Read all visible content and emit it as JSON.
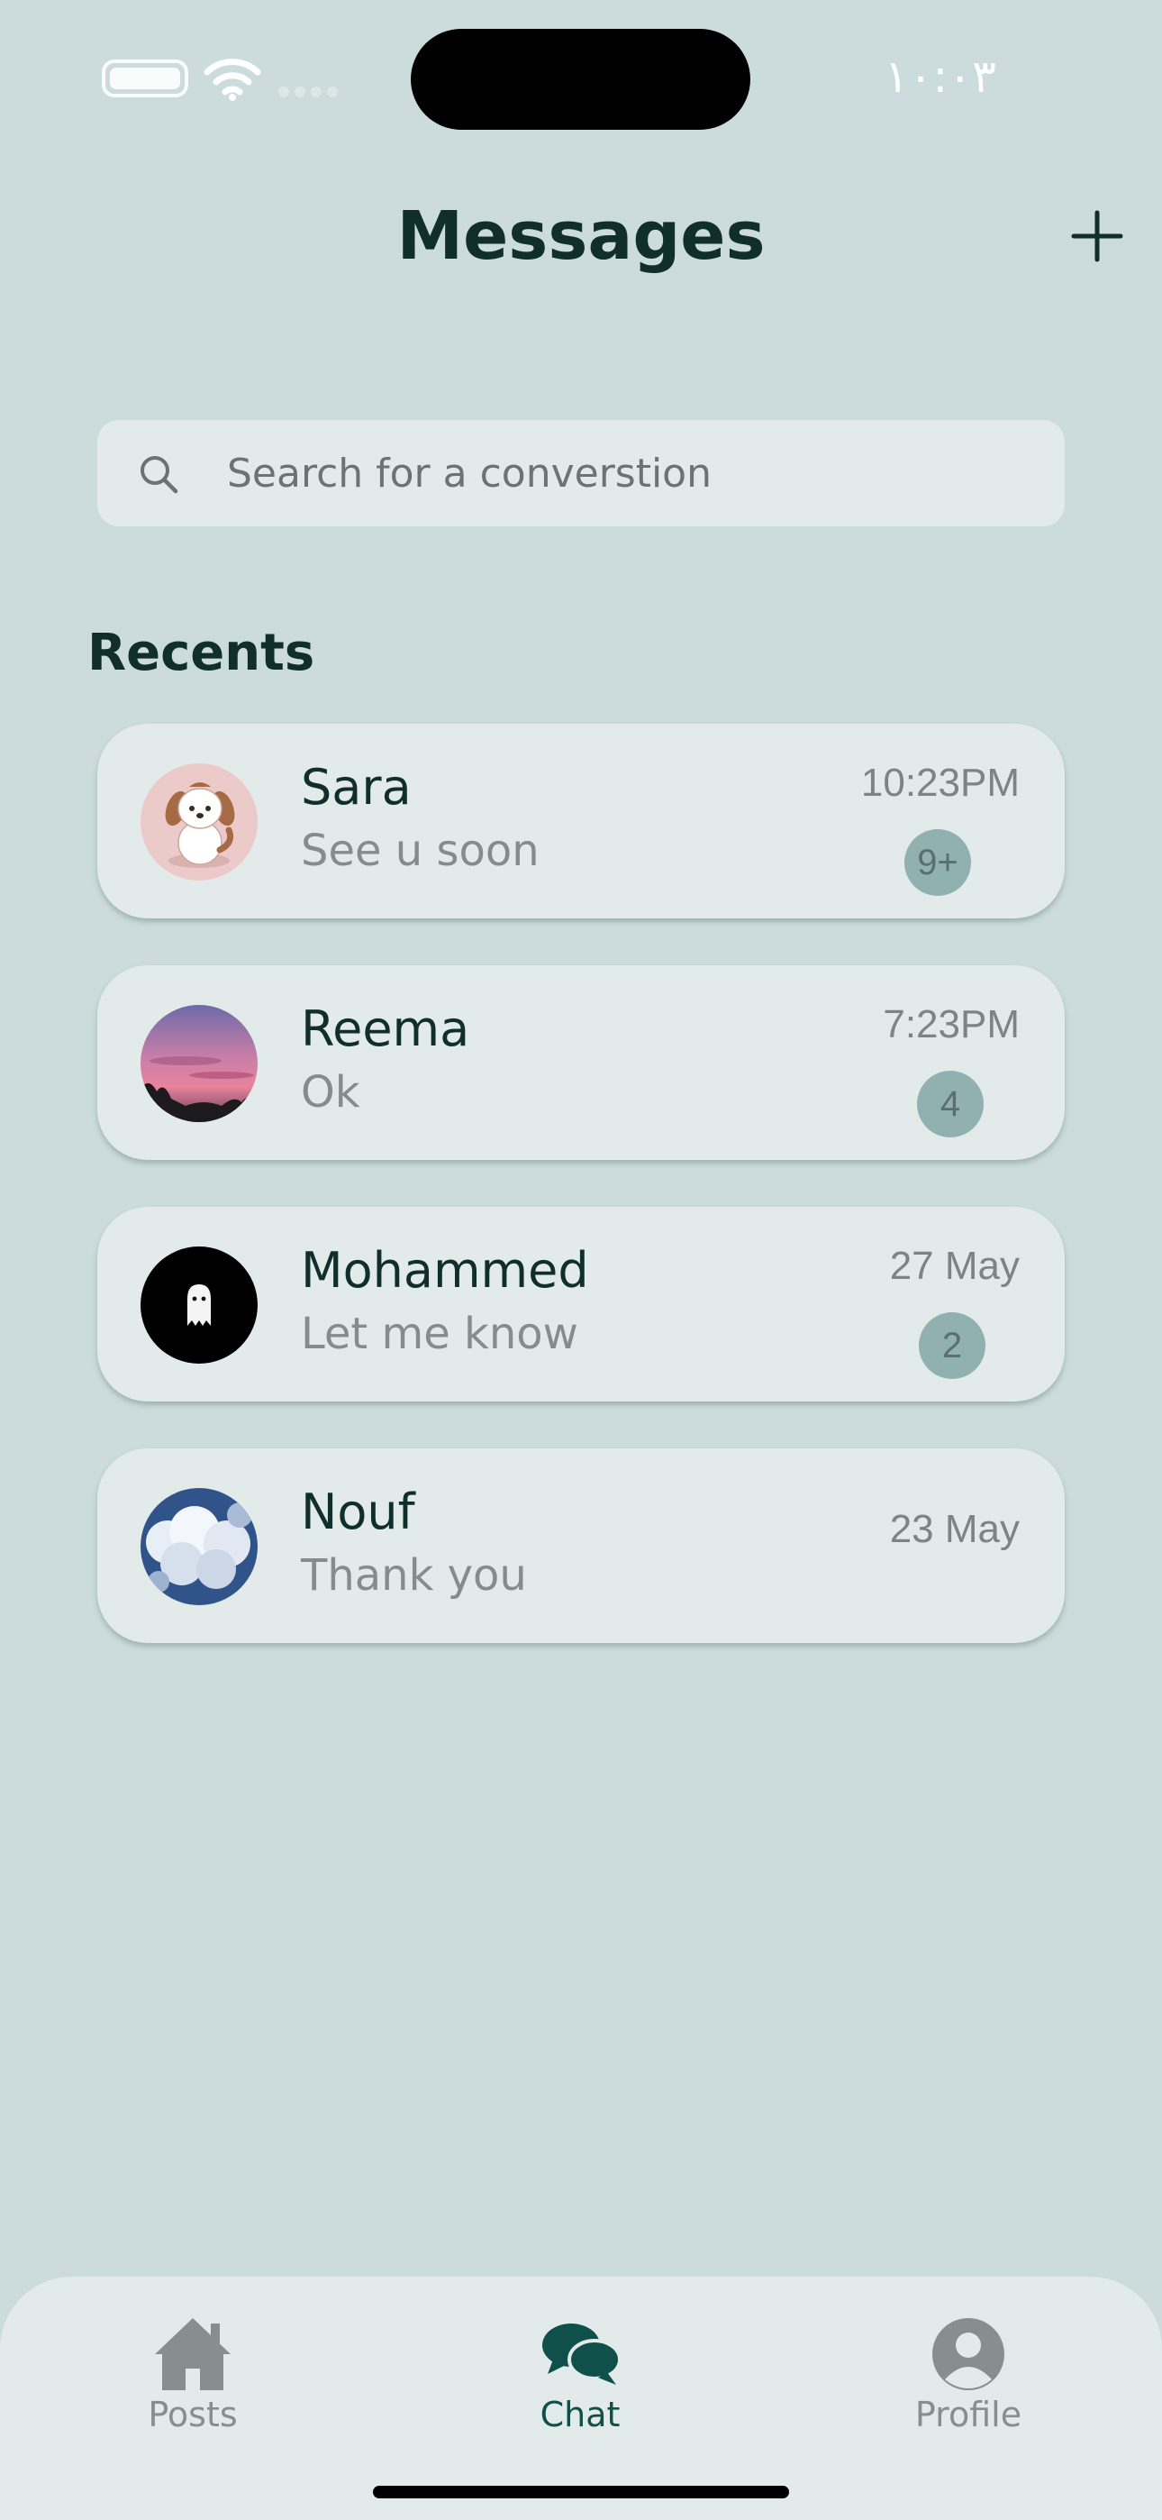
{
  "status_bar": {
    "time": "١٠:٠٣",
    "battery_icon": "battery-icon",
    "wifi_icon": "wifi-icon",
    "signal_icon": "cellular-signal-icon"
  },
  "header": {
    "title": "Messages",
    "add_icon": "plus-icon"
  },
  "search": {
    "placeholder": "Search for a converstion",
    "icon": "search-icon"
  },
  "recents": {
    "heading": "Recents",
    "chats": [
      {
        "name": "Sara",
        "preview": "See u soon",
        "time": "10:23PM",
        "badge": "9+",
        "avatar": "puppy-cartoon-avatar"
      },
      {
        "name": "Reema",
        "preview": "Ok",
        "time": "7:23PM",
        "badge": "4",
        "avatar": "sunset-sky-avatar"
      },
      {
        "name": "Mohammed",
        "preview": "Let me know",
        "time": "27 May",
        "badge": "2",
        "avatar": "ghost-avatar"
      },
      {
        "name": "Nouf",
        "preview": "Thank you",
        "time": "23 May",
        "badge": "",
        "avatar": "cloudy-sky-avatar"
      }
    ]
  },
  "tab_bar": {
    "tabs": [
      {
        "label": "Posts",
        "icon": "house-icon",
        "active": false
      },
      {
        "label": "Chat",
        "icon": "chat-bubbles-icon",
        "active": true
      },
      {
        "label": "Profile",
        "icon": "person-circle-icon",
        "active": false
      }
    ]
  },
  "colors": {
    "background": "#ccdbdb",
    "card": "#e2eaea",
    "primary_text": "#0f2e2c",
    "accent": "#10504b",
    "badge": "#91b1b0",
    "muted_text": "#858c8c"
  }
}
